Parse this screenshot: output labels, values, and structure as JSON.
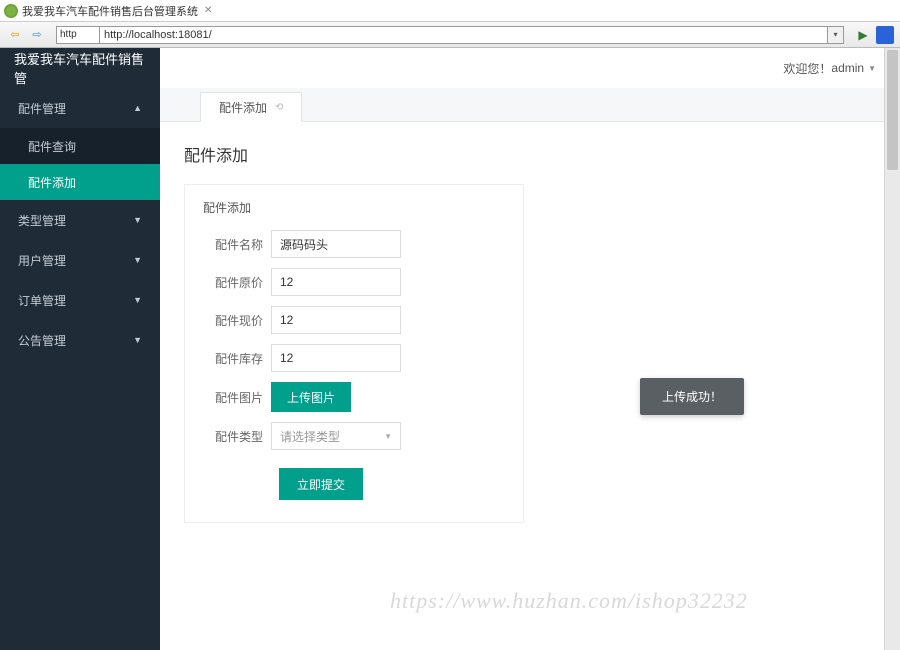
{
  "browser": {
    "tab_title": "我爱我车汽车配件销售后台管理系统",
    "tab_close": "✕",
    "scheme": "http",
    "url": "http://localhost:18081/"
  },
  "sidebar": {
    "brand": "我爱我车汽车配件销售管",
    "groups": [
      {
        "label": "配件管理",
        "expanded": true,
        "items": [
          {
            "label": "配件查询",
            "active": false
          },
          {
            "label": "配件添加",
            "active": true
          }
        ]
      },
      {
        "label": "类型管理",
        "expanded": false
      },
      {
        "label": "用户管理",
        "expanded": false
      },
      {
        "label": "订单管理",
        "expanded": false
      },
      {
        "label": "公告管理",
        "expanded": false
      }
    ]
  },
  "topbar": {
    "welcome": "欢迎您！",
    "username": "admin"
  },
  "tabs": [
    {
      "label": "配件添加"
    }
  ],
  "page": {
    "title": "配件添加",
    "card_title": "配件添加",
    "fields": {
      "name": {
        "label": "配件名称",
        "value": "源码码头"
      },
      "orig_price": {
        "label": "配件原价",
        "value": "12"
      },
      "now_price": {
        "label": "配件现价",
        "value": "12"
      },
      "stock": {
        "label": "配件库存",
        "value": "12"
      },
      "image": {
        "label": "配件图片",
        "button": "上传图片"
      },
      "type": {
        "label": "配件类型",
        "placeholder": "请选择类型"
      }
    },
    "submit": "立即提交"
  },
  "toast": "上传成功！",
  "watermark": "https://www.huzhan.com/ishop32232"
}
